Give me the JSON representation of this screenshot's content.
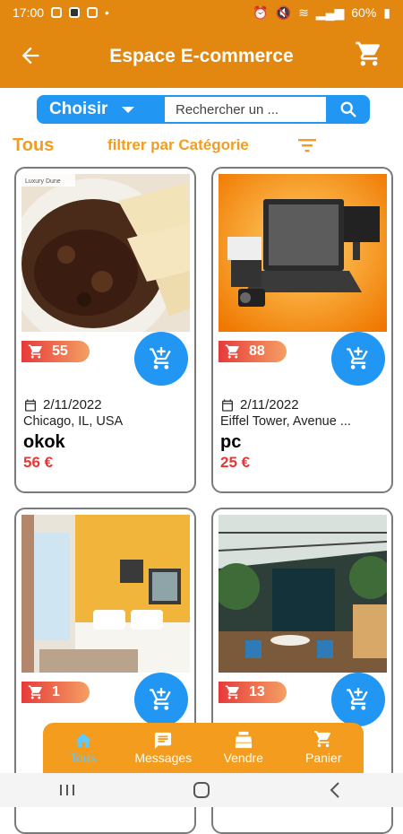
{
  "status_bar": {
    "time": "17:00",
    "battery": "60%"
  },
  "app_bar": {
    "title": "Espace E-commerce"
  },
  "search": {
    "choose_label": "Choisir",
    "placeholder": "Rechercher un ..."
  },
  "filter": {
    "all_label": "Tous",
    "category_label": "filtrer par Catégorie"
  },
  "products": [
    {
      "count": "55",
      "date": "2/11/2022",
      "location": "Chicago, IL, USA",
      "name": "okok",
      "price": "56 €",
      "image_caption": "Luxury Dune"
    },
    {
      "count": "88",
      "date": "2/11/2022",
      "location": "Eiffel Tower, Avenue ...",
      "name": "pc",
      "price": "25 €"
    },
    {
      "count": "1"
    },
    {
      "count": "13"
    }
  ],
  "bottom_nav": [
    {
      "label": "Tous",
      "icon": "home-icon",
      "active": true
    },
    {
      "label": "Messages",
      "icon": "message-icon"
    },
    {
      "label": "Vendre",
      "icon": "register-icon"
    },
    {
      "label": "Panier",
      "icon": "cart-icon"
    }
  ],
  "colors": {
    "primary": "#e28710",
    "accent": "#2196f3",
    "price": "#e53935",
    "nav_active": "#5ec8ff"
  }
}
